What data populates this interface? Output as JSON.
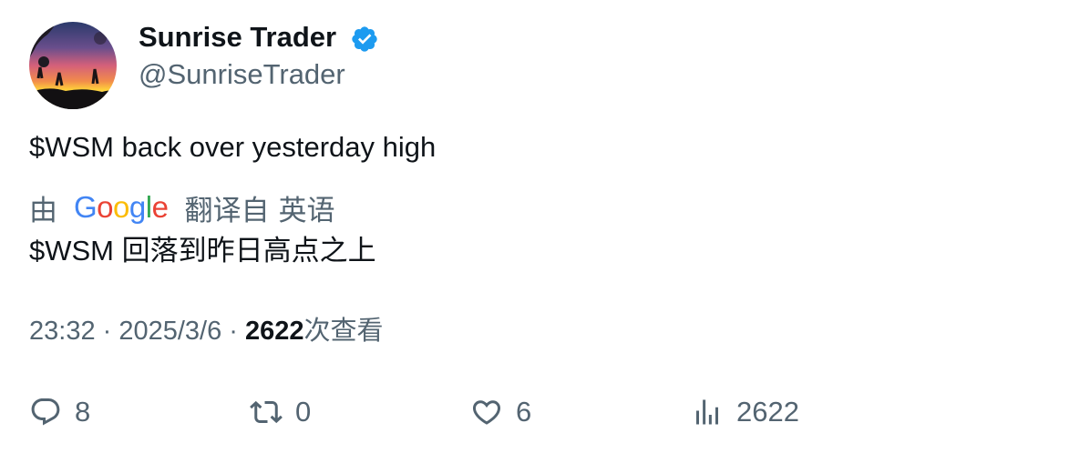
{
  "tweet": {
    "author": {
      "display_name": "Sunrise Trader",
      "handle": "@SunriseTrader",
      "verified": true
    },
    "text": "$WSM back over yesterday high",
    "translation": {
      "by_label": "由",
      "provider_letters": [
        "G",
        "o",
        "o",
        "g",
        "l",
        "e"
      ],
      "translated_from_label": "翻译自",
      "source_language": "英语",
      "translated_text": "$WSM 回落到昨日高点之上"
    },
    "meta": {
      "time": "23:32",
      "separator": " · ",
      "date": "2025/3/6",
      "views_count": "2622",
      "views_label": "次查看"
    },
    "actions": {
      "replies": "8",
      "retweets": "0",
      "likes": "6",
      "views": "2622"
    }
  },
  "colors": {
    "text_primary": "#0f1419",
    "text_secondary": "#536471",
    "verified_blue": "#1d9bf0",
    "google_blue": "#4285F4",
    "google_red": "#EA4335",
    "google_yellow": "#FBBC05",
    "google_green": "#34A853"
  },
  "icons": {
    "verified": "verified-badge-icon",
    "reply": "reply-icon",
    "retweet": "retweet-icon",
    "like": "heart-icon",
    "views": "views-chart-icon"
  }
}
